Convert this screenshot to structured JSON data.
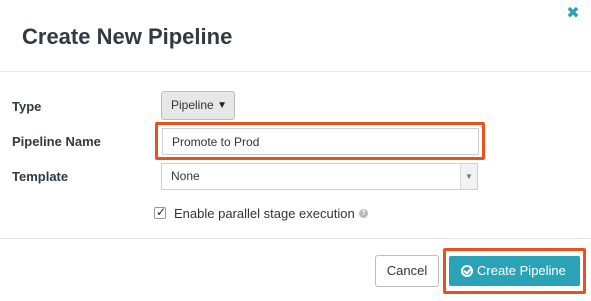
{
  "dialog": {
    "title": "Create New Pipeline",
    "close_icon": "close-icon"
  },
  "form": {
    "type": {
      "label": "Type",
      "selected": "Pipeline"
    },
    "name": {
      "label": "Pipeline Name",
      "value": "Promote to Prod"
    },
    "template": {
      "label": "Template",
      "selected": "None"
    },
    "parallel": {
      "label": "Enable parallel stage execution",
      "checked": true,
      "help_icon": "help-icon"
    }
  },
  "footer": {
    "cancel_label": "Cancel",
    "create_label": "Create Pipeline"
  },
  "colors": {
    "accent": "#2aa3b6",
    "highlight": "#e8521e"
  }
}
